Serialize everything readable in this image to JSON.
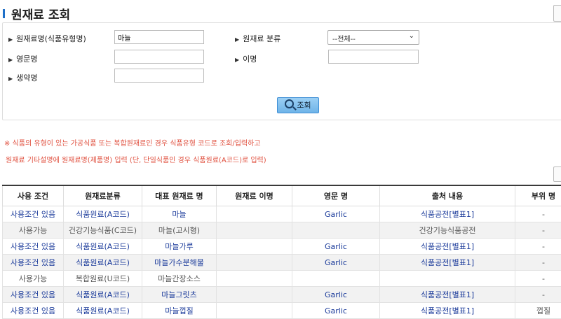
{
  "page": {
    "title": "원재료 조회"
  },
  "search": {
    "name_label": "원재료명(식품유형명)",
    "name_value": "마늘",
    "category_label": "원재료 분류",
    "category_selected": "--전체--",
    "english_label": "영문명",
    "english_value": "",
    "alias_label": "이명",
    "alias_value": "",
    "scientific_label": "생약명",
    "scientific_value": "",
    "button_label": "조회"
  },
  "notice": {
    "line1": "※ 식품의 유형이 있는 가공식품 또는 복합원재료인 경우 식품유형 코드로 조회/입력하고",
    "line2": "원재료 기타설명에 원재료명(제품명) 입력 (단, 단일식품인 경우 식품원료(A코드)로 입력)"
  },
  "table": {
    "headers": [
      "사용 조건",
      "원재료분류",
      "대표 원재료 명",
      "원재료 이명",
      "영문 명",
      "출처 내용",
      "부위 명"
    ],
    "rows": [
      {
        "condition": "사용조건 있음",
        "category": "식품원료(A코드)",
        "name": "마늘",
        "alias": "",
        "english": "Garlic",
        "source": "식품공전[별표1]",
        "part": "-",
        "style": "link"
      },
      {
        "condition": "사용가능",
        "category": "건강기능식품(C코드)",
        "name": "마늘(고시형)",
        "alias": "",
        "english": "",
        "source": "건강기능식품공전",
        "part": "-",
        "style": "plain"
      },
      {
        "condition": "사용조건 있음",
        "category": "식품원료(A코드)",
        "name": "마늘가루",
        "alias": "",
        "english": "Garlic",
        "source": "식품공전[별표1]",
        "part": "-",
        "style": "link"
      },
      {
        "condition": "사용조건 있음",
        "category": "식품원료(A코드)",
        "name": "마늘가수분해물",
        "alias": "",
        "english": "Garlic",
        "source": "식품공전[별표1]",
        "part": "-",
        "style": "link"
      },
      {
        "condition": "사용가능",
        "category": "복합원료(U코드)",
        "name": "마늘간장소스",
        "alias": "",
        "english": "",
        "source": "",
        "part": "-",
        "style": "plain"
      },
      {
        "condition": "사용조건 있음",
        "category": "식품원료(A코드)",
        "name": "마늘그릿츠",
        "alias": "",
        "english": "Garlic",
        "source": "식품공전[별표1]",
        "part": "-",
        "style": "link"
      },
      {
        "condition": "사용조건 있음",
        "category": "식품원료(A코드)",
        "name": "마늘껍질",
        "alias": "",
        "english": "Garlic",
        "source": "식품공전[별표1]",
        "part": "껍질",
        "style": "link"
      }
    ]
  }
}
